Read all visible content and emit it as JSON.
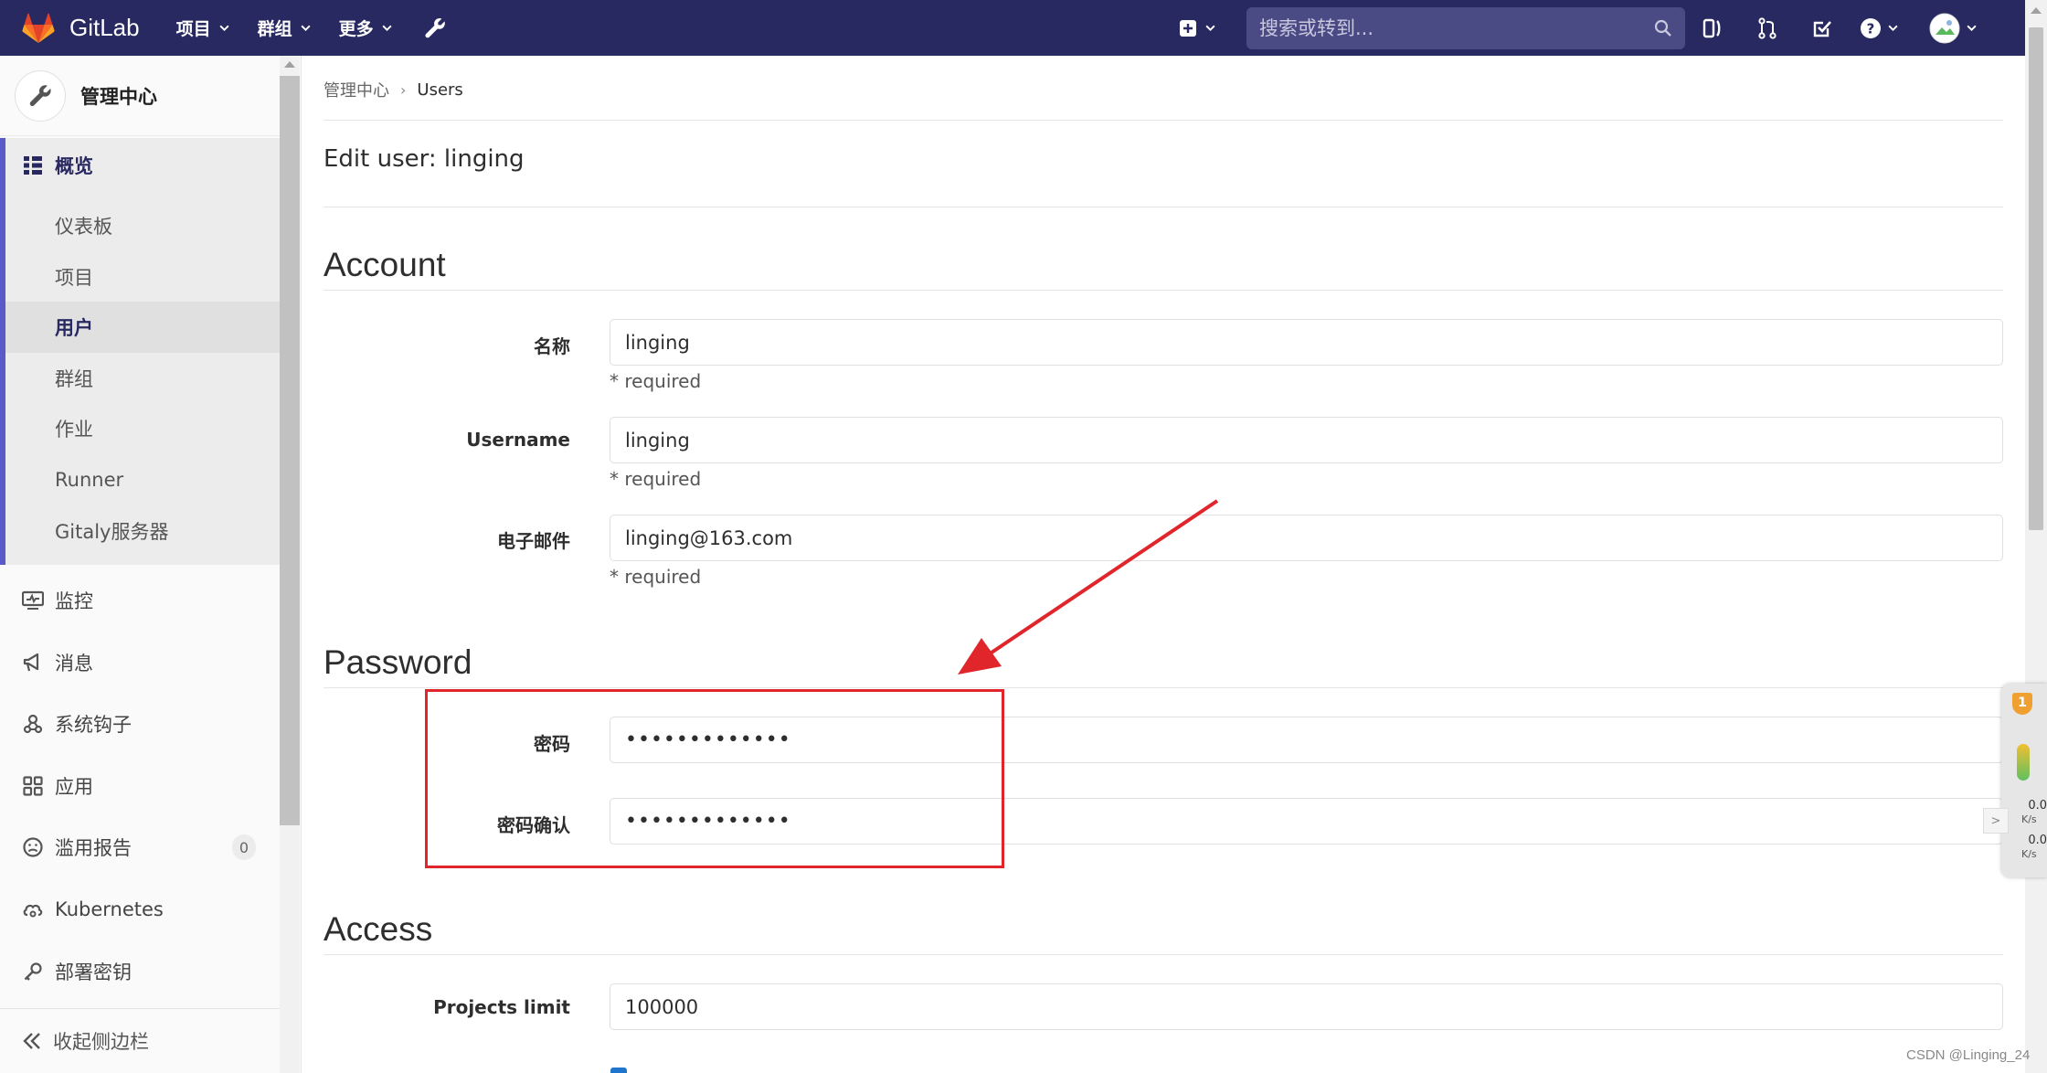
{
  "navbar": {
    "brand": "GitLab",
    "menu": [
      {
        "label": "项目"
      },
      {
        "label": "群组"
      },
      {
        "label": "更多"
      }
    ],
    "search_placeholder": "搜索或转到..."
  },
  "sidebar": {
    "title": "管理中心",
    "overview_label": "概览",
    "overview_items": [
      {
        "label": "仪表板"
      },
      {
        "label": "项目"
      },
      {
        "label": "用户"
      },
      {
        "label": "群组"
      },
      {
        "label": "作业"
      },
      {
        "label": "Runner"
      },
      {
        "label": "Gitaly服务器"
      }
    ],
    "items": [
      {
        "label": "监控"
      },
      {
        "label": "消息"
      },
      {
        "label": "系统钩子"
      },
      {
        "label": "应用"
      },
      {
        "label": "滥用报告",
        "badge": "0"
      },
      {
        "label": "Kubernetes"
      },
      {
        "label": "部署密钥"
      }
    ],
    "collapse_label": "收起侧边栏"
  },
  "breadcrumb": {
    "root": "管理中心",
    "current": "Users"
  },
  "page": {
    "title": "Edit user: linging",
    "sections": {
      "account": "Account",
      "password": "Password",
      "access": "Access"
    },
    "fields": {
      "name": {
        "label": "名称",
        "value": "linging",
        "help": "* required"
      },
      "username": {
        "label": "Username",
        "value": "linging",
        "help": "* required"
      },
      "email": {
        "label": "电子邮件",
        "value": "linging@163.com",
        "help": "* required"
      },
      "password": {
        "label": "密码",
        "value": "•••••••••••••"
      },
      "password_confirm": {
        "label": "密码确认",
        "value": "•••••••••••••"
      },
      "projects_limit": {
        "label": "Projects limit",
        "value": "100000"
      }
    }
  },
  "net_widget": {
    "alert_count": "1",
    "upload_rate": "0.0",
    "upload_unit": "K/s",
    "download_rate": "0.0",
    "download_unit": "K/s"
  },
  "watermark": "CSDN @Linging_24",
  "colors": {
    "navbar": "#292961",
    "accent": "#5959c8",
    "annotation": "#e0262b"
  }
}
